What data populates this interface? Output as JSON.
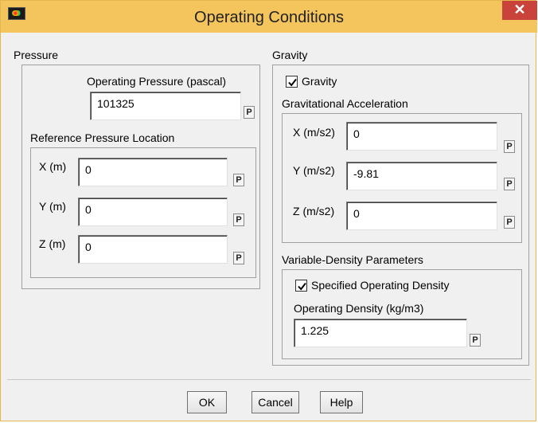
{
  "window": {
    "title": "Operating Conditions",
    "close_glyph": "✕"
  },
  "pressure": {
    "group_label": "Pressure",
    "operating_pressure_label": "Operating Pressure (pascal)",
    "operating_pressure_value": "101325",
    "ref_group_label": "Reference Pressure Location",
    "x_label": "X (m)",
    "x_value": "0",
    "y_label": "Y (m)",
    "y_value": "0",
    "z_label": "Z (m)",
    "z_value": "0"
  },
  "gravity": {
    "group_label": "Gravity",
    "checkbox_label": "Gravity",
    "checked": true,
    "accel_group_label": "Gravitational Acceleration",
    "x_label": "X (m/s2)",
    "x_value": "0",
    "y_label": "Y (m/s2)",
    "y_value": "-9.81",
    "z_label": "Z (m/s2)",
    "z_value": "0"
  },
  "density": {
    "group_label": "Variable-Density Parameters",
    "checkbox_label": "Specified Operating Density",
    "checked": true,
    "density_label": "Operating Density (kg/m3)",
    "density_value": "1.225"
  },
  "param_button_label": "P",
  "buttons": {
    "ok": "OK",
    "cancel": "Cancel",
    "help": "Help"
  },
  "colors": {
    "titlebar": "#f5c55d",
    "close": "#c9433b"
  }
}
